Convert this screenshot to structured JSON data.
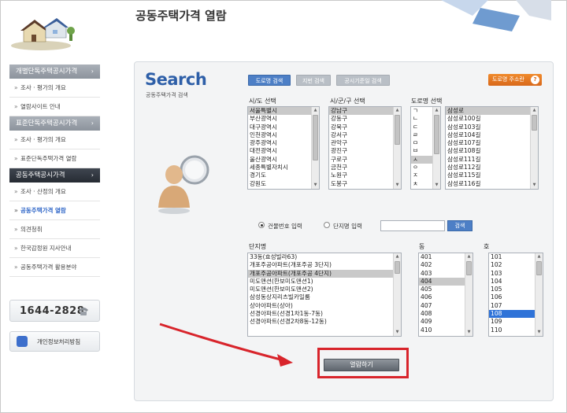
{
  "page_title": "공동주택가격 열람",
  "sidebar": {
    "groups": [
      {
        "title": "개별단독주택공시가격",
        "arrow": "›",
        "active": false,
        "items": [
          {
            "label": "조사 · 평가의 개요"
          },
          {
            "label": "열람사이트 안내"
          }
        ]
      },
      {
        "title": "표준단독주택공시가격",
        "arrow": "›",
        "active": false,
        "items": [
          {
            "label": "조사 · 평가의 개요"
          },
          {
            "label": "표준단독주택가격 열람"
          }
        ]
      },
      {
        "title": "공동주택공시가격",
        "arrow": "›",
        "active": true,
        "items": [
          {
            "label": "조사 · 산정의 개요"
          },
          {
            "label": "공동주택가격 열람",
            "selected": true
          },
          {
            "label": "의견청취"
          },
          {
            "label": "한국감정원 지사안내"
          },
          {
            "label": "공동주택가격 활용분야"
          }
        ]
      }
    ],
    "phone": "1644-2828",
    "privacy": "개인정보처리방침"
  },
  "search": {
    "title": "Search",
    "subtitle": "공동주택가격 검색",
    "tabs": [
      {
        "label": "도로명 검색",
        "active": true
      },
      {
        "label": "지번 검색",
        "active": false
      },
      {
        "label": "공시기준일 검색",
        "active": false
      }
    ],
    "road_button": "도로명 주소란",
    "road_button_icon": "?"
  },
  "lists": {
    "sido": {
      "header": "시/도 선택",
      "options": [
        "서울특별시",
        "부산광역시",
        "대구광역시",
        "인천광역시",
        "광주광역시",
        "대전광역시",
        "울산광역시",
        "세종특별자치시",
        "경기도",
        "강원도"
      ],
      "selected": 0
    },
    "sigungu": {
      "header": "시/군/구 선택",
      "options": [
        "강남구",
        "강동구",
        "강북구",
        "강서구",
        "관악구",
        "광진구",
        "구로구",
        "금천구",
        "노원구",
        "도봉구"
      ],
      "selected": 0
    },
    "road_initial": {
      "header": "도로명 선택",
      "options": [
        "ㄱ",
        "ㄴ",
        "ㄷ",
        "ㄹ",
        "ㅁ",
        "ㅂ",
        "ㅅ",
        "ㅇ",
        "ㅈ",
        "ㅊ"
      ],
      "selected": 6
    },
    "road_name": {
      "options": [
        "삼성로",
        "삼성로100길",
        "삼성로103길",
        "삼성로104길",
        "삼성로107길",
        "삼성로108길",
        "삼성로111길",
        "삼성로112길",
        "삼성로115길",
        "삼성로116길"
      ],
      "selected": 0
    }
  },
  "input_mode": {
    "options": [
      {
        "label": "건물번호 입력",
        "checked": true
      },
      {
        "label": "단지명 입력",
        "checked": false
      }
    ],
    "search_button": "검색"
  },
  "complex": {
    "header": "단지명",
    "options": [
      "33동(효성빌라63)",
      "개포주공아파트(개포주공 3단지)",
      "개포주공아파트(개포주공 4단지)",
      "미도맨션(한보미도맨션1)",
      "미도맨션(한보미도맨션2)",
      "삼성동상지리츠빌카일룸",
      "상아아파트(상아)",
      "선경아파트(선경1차1동-7동)",
      "선경아파트(선경2차8동-12동)"
    ],
    "selected": 2
  },
  "dong": {
    "header": "동",
    "options": [
      "401",
      "402",
      "403",
      "404",
      "405",
      "406",
      "407",
      "408",
      "409",
      "410"
    ],
    "selected": 3
  },
  "ho": {
    "header": "호",
    "options": [
      "101",
      "102",
      "103",
      "104",
      "105",
      "106",
      "107",
      "108",
      "109",
      "110"
    ],
    "selected": 7
  },
  "view_button": "열람하기",
  "colors": {
    "highlight_red": "#d8242b",
    "accent_blue": "#4d7fc6",
    "arrow_red": "#d8242b",
    "title_blue": "#2e5fa8"
  }
}
